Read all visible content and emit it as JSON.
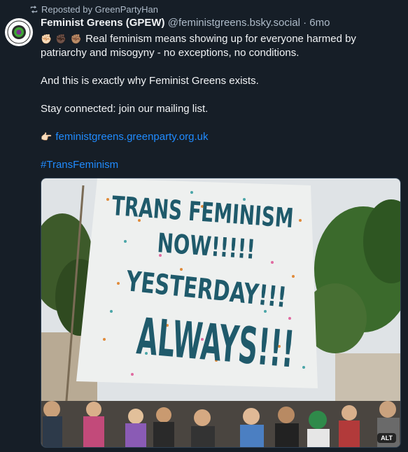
{
  "repost": {
    "icon": "repost-icon",
    "text": "Reposted by GreenPartyHan"
  },
  "author": {
    "display_name": "Feminist Greens (GPEW)",
    "handle": "@feministgreens.bsky.social",
    "separator": "·",
    "time": "6mo"
  },
  "post": {
    "line1_emoji": [
      "✊🏻",
      "✊🏿",
      "✊🏽"
    ],
    "line1_text": "Real feminism means showing up for everyone harmed by patriarchy and misogyny - no exceptions, no conditions.",
    "line2": "And this is exactly why Feminist Greens exists.",
    "line3": "Stay connected: join our mailing list.",
    "link_emoji": "👉🏻",
    "link": "feministgreens.greenparty.org.uk",
    "hashtag": "#TransFeminism"
  },
  "image": {
    "sign_lines": [
      "TRANS FEMINISM",
      "NOW!!!!!",
      "YESTERDAY!!!",
      "ALWAYS!!!"
    ],
    "alt_badge": "ALT"
  },
  "colors": {
    "background": "#161e27",
    "link": "#208bfe",
    "muted": "#aebbc9"
  }
}
